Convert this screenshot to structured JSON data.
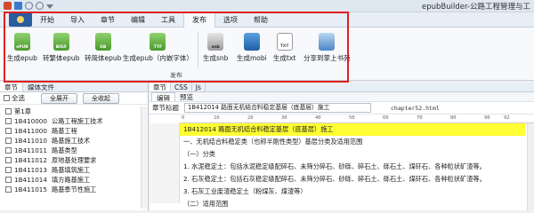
{
  "app": {
    "title": "epubBuilder-公路工程管理与工"
  },
  "ribbon": {
    "tabs": [
      "开始",
      "导入",
      "章节",
      "编辑",
      "工具",
      "发布",
      "选项",
      "帮助"
    ],
    "active_tab": "发布",
    "buttons": [
      {
        "label": "生成epub",
        "icon_text": "ePUB",
        "icon": "epub-icon"
      },
      {
        "label": "转繁体epub",
        "icon_text": "BIG5",
        "icon": "epub-big5-icon"
      },
      {
        "label": "转简体epub",
        "icon_text": "GB",
        "icon": "epub-gb-icon"
      },
      {
        "label": "生成epub（内嵌字体）",
        "icon_text": "TTF",
        "icon": "epub-ttf-icon"
      },
      {
        "label": "生成snb",
        "icon_text": "snb",
        "icon": "snb-icon"
      },
      {
        "label": "生成mobi",
        "icon_text": "",
        "icon": "mobi-book-icon"
      },
      {
        "label": "生成txt",
        "icon_text": "TXT",
        "icon": "txt-icon"
      },
      {
        "label": "分享到掌上书苑",
        "icon_text": "",
        "icon": "share-icon"
      }
    ],
    "group_label": "发布"
  },
  "left": {
    "tabs": [
      "章节",
      "媒体文件"
    ],
    "select_all": "全选",
    "expand_all": "全展开",
    "collapse_all": "全收起",
    "tree": [
      {
        "code": "第1章",
        "title": ""
      },
      {
        "code": "1B410000",
        "title": "公路工程施工技术"
      },
      {
        "code": "1B411000",
        "title": "路基工程"
      },
      {
        "code": "1B411010",
        "title": "路基施工技术"
      },
      {
        "code": "1B411011",
        "title": "路基类型"
      },
      {
        "code": "1B411012",
        "title": "原地基处理要求"
      },
      {
        "code": "1B411013",
        "title": "路基填筑施工"
      },
      {
        "code": "1B411014",
        "title": "填方路基施工"
      },
      {
        "code": "1B411015",
        "title": "路基季节性施工"
      }
    ]
  },
  "editor": {
    "tabs": [
      "章节",
      "CSS",
      "Js"
    ],
    "subtabs": [
      "编辑",
      "预览"
    ],
    "title_label": "章节标题",
    "title_value": "1B412014  路面无机结合料稳定基层（底基层）施工",
    "filename": "chapter52.html",
    "ruler": [
      "0",
      "10",
      "20",
      "30",
      "40",
      "50",
      "60",
      "70",
      "80",
      "90",
      "92"
    ],
    "lines": [
      "1B412014  路面无机结合料稳定基层（底基层）施工",
      "一、无机结合料稳定类（也称半刚性类型）基层分类及适用范围",
      "（一）分类",
      "1. 水泥稳定土：包括水泥稳定级配碎石、未筛分碎石、砂砾、碎石土、砾石土、煤矸石、各种粒状矿渣等。",
      "2. 石灰稳定土：包括石灰稳定级配碎石、未筛分碎石、砂砾、碎石土、砾石土、煤矸石、各种粒状矿渣等。",
      "3. 石灰工业废渣稳定土（粉煤灰、煤渣等）",
      "（二）适用范围"
    ]
  }
}
